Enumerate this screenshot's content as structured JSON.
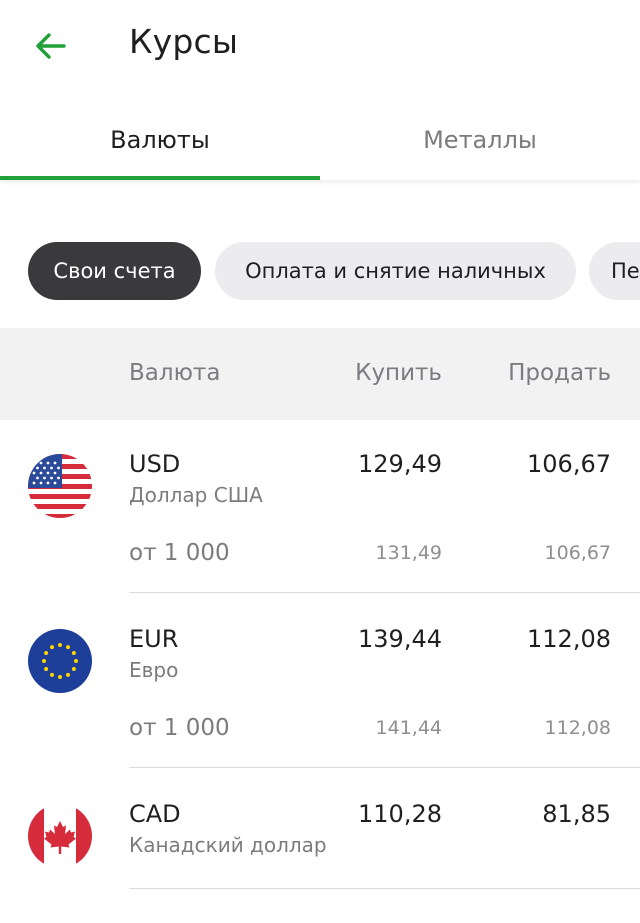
{
  "header": {
    "title": "Курсы",
    "back_icon": "arrow-left-icon",
    "accent_color": "#21a038"
  },
  "tabs": [
    {
      "label": "Валюты",
      "active": true
    },
    {
      "label": "Металлы",
      "active": false
    }
  ],
  "chips": [
    {
      "label": "Свои счета",
      "selected": true
    },
    {
      "label": "Оплата и снятие наличных",
      "selected": false
    },
    {
      "label": "Пе",
      "selected": false
    }
  ],
  "table": {
    "headers": {
      "currency": "Валюта",
      "buy": "Купить",
      "sell": "Продать"
    },
    "rows": [
      {
        "code": "USD",
        "name": "Доллар США",
        "buy": "129,49",
        "sell": "106,67",
        "tier": {
          "label": "от 1 000",
          "buy": "131,49",
          "sell": "106,67"
        },
        "flag": "us-flag-icon"
      },
      {
        "code": "EUR",
        "name": "Евро",
        "buy": "139,44",
        "sell": "112,08",
        "tier": {
          "label": "от 1 000",
          "buy": "141,44",
          "sell": "112,08"
        },
        "flag": "eu-flag-icon"
      },
      {
        "code": "CAD",
        "name": "Канадский доллар",
        "buy": "110,28",
        "sell": "81,85",
        "flag": "canada-flag-icon"
      }
    ]
  }
}
